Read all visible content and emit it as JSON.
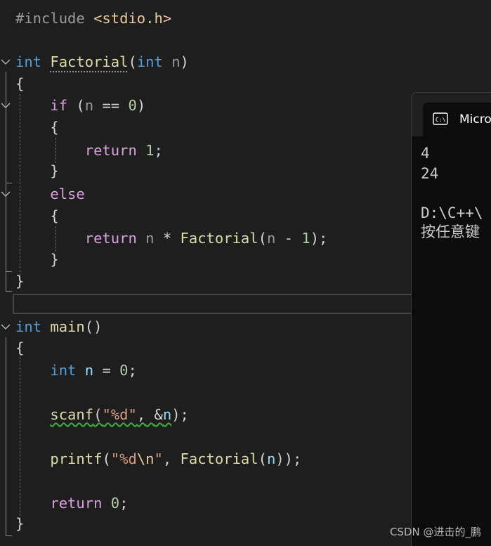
{
  "editor": {
    "code": {
      "l1": {
        "hash": "#include",
        "header": "<stdio.h>"
      },
      "l3": {
        "type": "int",
        "fn": "Factorial",
        "open": "(",
        "ptype": "int",
        "param": "n",
        "close": ")"
      },
      "l4": {
        "brace": "{"
      },
      "l5": {
        "kw": "if",
        "open": "(",
        "var": "n",
        "op": "==",
        "num": "0",
        "close": ")"
      },
      "l6": {
        "brace": "{"
      },
      "l7": {
        "kw": "return",
        "num": "1",
        "semi": ";"
      },
      "l8": {
        "brace": "}"
      },
      "l9": {
        "kw": "else"
      },
      "l10": {
        "brace": "{"
      },
      "l11": {
        "kw": "return",
        "var": "n",
        "op": "*",
        "fn": "Factorial",
        "open": "(",
        "var2": "n",
        "op2": "-",
        "num": "1",
        "close": ");"
      },
      "l12": {
        "brace": "}"
      },
      "l13": {
        "brace": "}"
      },
      "l15": {
        "type": "int",
        "fn": "main",
        "parens": "()"
      },
      "l16": {
        "brace": "{"
      },
      "l17": {
        "type": "int",
        "var": "n",
        "op": "=",
        "num": "0",
        "semi": ";"
      },
      "l19": {
        "fn": "scanf",
        "open": "(",
        "fmt": "\"%d\"",
        "comma": ",",
        "amp": "&",
        "var": "n",
        "close": ");"
      },
      "l21": {
        "fn": "printf",
        "open": "(",
        "fmt_a": "\"%d",
        "esc": "\\n",
        "fmt_b": "\"",
        "comma": ",",
        "fn2": "Factorial",
        "open2": "(",
        "var": "n",
        "close": "));"
      },
      "l23": {
        "kw": "return",
        "num": "0",
        "semi": ";"
      },
      "l24": {
        "brace": "}"
      }
    }
  },
  "console": {
    "tab_title": "Micro",
    "tab_icon": "terminal-icon",
    "output": [
      "4",
      "24",
      "",
      "D:\\C++\\",
      "按任意键"
    ]
  },
  "watermark": "CSDN @进击的_鹏",
  "colors": {
    "background": "#1e1e1e",
    "keyword_type": "#569cd6",
    "keyword_control": "#d8a0df",
    "function": "#dcdcaa",
    "variable": "#9cdcfe",
    "number": "#b5cea8",
    "string": "#d69d85",
    "console_bg": "#0c0c0c"
  }
}
